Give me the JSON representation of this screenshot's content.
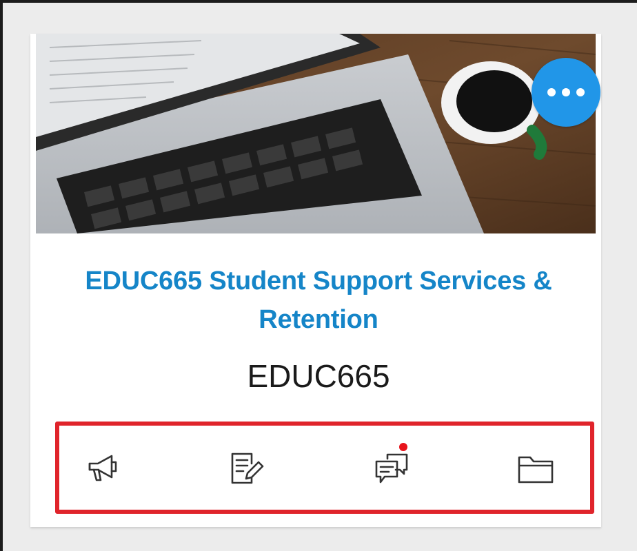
{
  "course_card": {
    "title": "EDUC665 Student Support Services & Retention",
    "code": "EDUC665",
    "banner_image": "laptop-and-coffee-photo",
    "more_button_icon": "more-horizontal-icon"
  },
  "actions": [
    {
      "icon": "announcements-megaphone-icon",
      "has_badge": false
    },
    {
      "icon": "assignments-edit-icon",
      "has_badge": false
    },
    {
      "icon": "discussions-chat-icon",
      "has_badge": true
    },
    {
      "icon": "files-folder-icon",
      "has_badge": false
    }
  ],
  "colors": {
    "accent": "#2196e8",
    "title": "#1585c8",
    "highlight_border": "#e0242b",
    "badge": "#e8141c"
  }
}
